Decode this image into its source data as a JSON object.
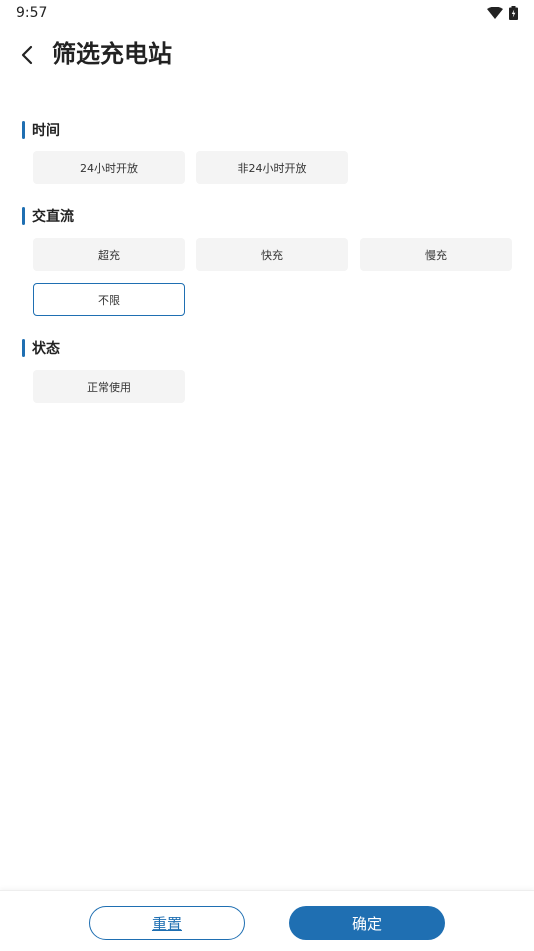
{
  "status_bar": {
    "time": "9:57",
    "icons": [
      "wifi-icon",
      "battery-icon"
    ]
  },
  "header": {
    "back_icon": "chevron-left-icon",
    "title": "筛选充电站"
  },
  "sections": [
    {
      "title": "时间",
      "options": [
        {
          "label": "24小时开放",
          "selected": false
        },
        {
          "label": "非24小时开放",
          "selected": false
        }
      ]
    },
    {
      "title": "交直流",
      "options": [
        {
          "label": "超充",
          "selected": false
        },
        {
          "label": "快充",
          "selected": false
        },
        {
          "label": "慢充",
          "selected": false
        },
        {
          "label": "不限",
          "selected": true
        }
      ]
    },
    {
      "title": "状态",
      "options": [
        {
          "label": "正常使用",
          "selected": false
        }
      ]
    }
  ],
  "footer": {
    "reset_label": "重置",
    "confirm_label": "确定"
  },
  "colors": {
    "accent": "#1f6fb2",
    "chip_bg": "#f4f4f4"
  }
}
